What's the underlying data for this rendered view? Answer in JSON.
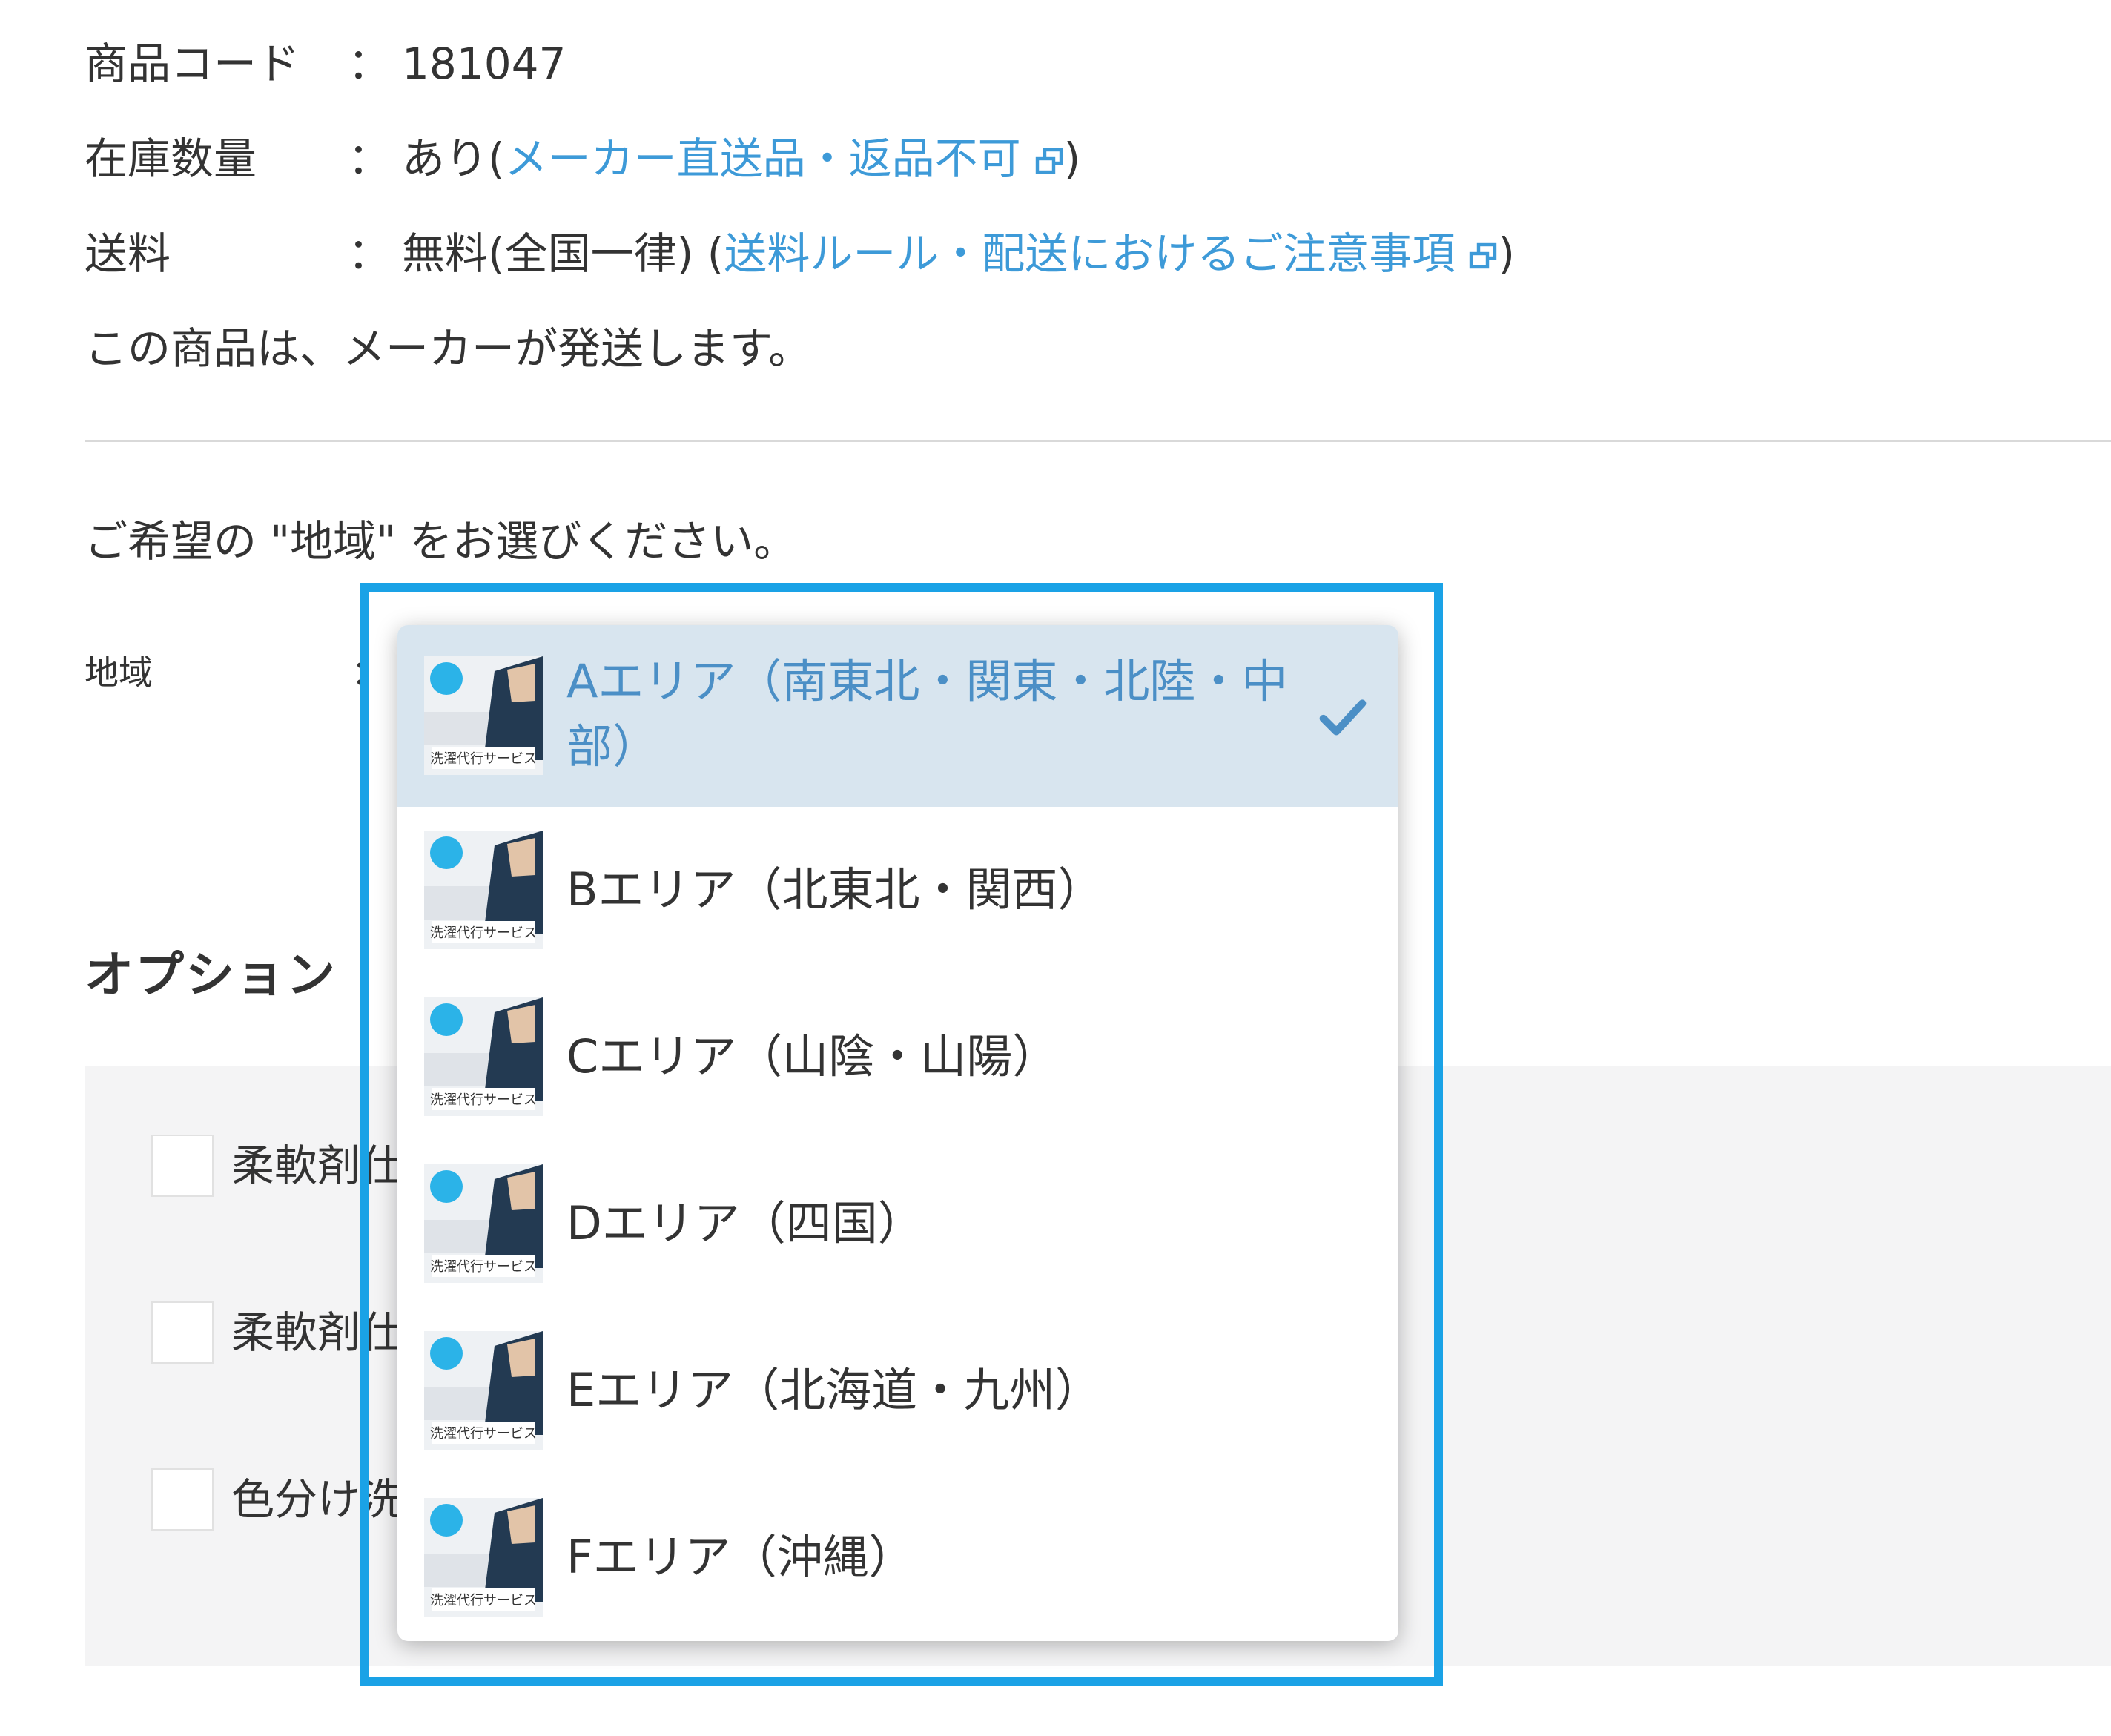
{
  "product": {
    "code_label": "商品コード",
    "code_value": "181047",
    "stock_label": "在庫数量",
    "stock_value_prefix": "あり(",
    "stock_link": "メーカー直送品・返品不可",
    "stock_value_suffix": ")",
    "shipping_label": "送料",
    "shipping_value_prefix": "無料(全国一律) (",
    "shipping_link": "送料ルール・配送におけるご注意事項",
    "shipping_value_suffix": ")",
    "colon": "：",
    "maker_note": "この商品は、メーカーが発送します。"
  },
  "region": {
    "prompt": "ご希望の \"地域\" をお選びください。",
    "label": "地域",
    "colon": "："
  },
  "options": {
    "heading": "オプション",
    "items": [
      {
        "label": "柔軟剤仕"
      },
      {
        "label": "柔軟剤仕"
      },
      {
        "label": "色分け洗"
      }
    ]
  },
  "dropdown": {
    "thumbnail_caption": "洗濯代行サービス",
    "items": [
      {
        "label": "Aエリア（南東北・関東・北陸・中部）",
        "selected": true
      },
      {
        "label": "Bエリア（北東北・関西）",
        "selected": false
      },
      {
        "label": "Cエリア（山陰・山陽）",
        "selected": false
      },
      {
        "label": "Dエリア（四国）",
        "selected": false
      },
      {
        "label": "Eエリア（北海道・九州）",
        "selected": false
      },
      {
        "label": "Fエリア（沖縄）",
        "selected": false
      }
    ]
  },
  "colors": {
    "link": "#3d9ad8",
    "selected_bg": "#d8e5ef",
    "selected_text": "#4b8fc6",
    "highlight": "#1aa2e6",
    "panel_bg": "#f4f4f5"
  },
  "icons": {
    "external_link": "external-link-icon",
    "check": "check-icon"
  }
}
